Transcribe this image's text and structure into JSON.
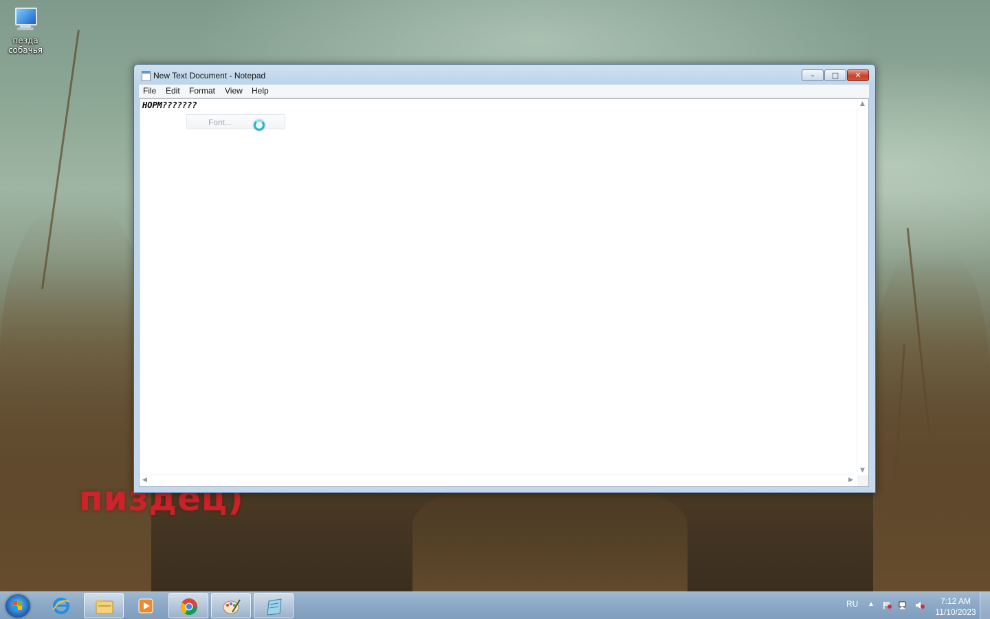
{
  "desktop": {
    "icons": [
      {
        "label": "пезда собачья",
        "icon": "computer-icon"
      }
    ],
    "wallpaper_text": "пиздец)"
  },
  "window": {
    "title": "New Text Document - Notepad",
    "controls": {
      "minimize": "–",
      "maximize": "□",
      "close": "✕"
    },
    "menu": [
      "File",
      "Edit",
      "Format",
      "View",
      "Help"
    ],
    "content": "НОРМ???????",
    "popup": {
      "label": "Font..."
    }
  },
  "taskbar": {
    "pinned": [
      {
        "name": "internet-explorer",
        "active": false
      },
      {
        "name": "windows-explorer",
        "active": true
      },
      {
        "name": "media-player",
        "active": false
      },
      {
        "name": "chrome",
        "active": true
      },
      {
        "name": "paint",
        "active": true
      },
      {
        "name": "notepad",
        "active": true
      }
    ],
    "tray": {
      "language": "RU",
      "time": "7:12 AM",
      "date": "11/10/2023"
    }
  },
  "colors": {
    "accent": "#1b5aa8",
    "close_button": "#c6402b",
    "wallpaper_text": "#d8202a"
  }
}
